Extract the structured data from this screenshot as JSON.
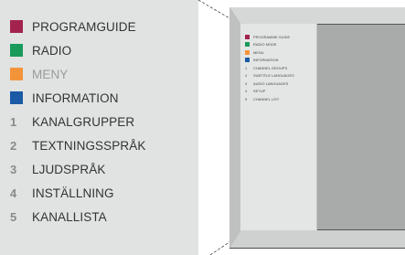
{
  "menu": {
    "items": [
      {
        "label": "PROGRAMGUIDE",
        "marker": "swatch",
        "color": "#a3234f",
        "muted": false
      },
      {
        "label": "RADIO",
        "marker": "swatch",
        "color": "#1a9a5b",
        "muted": false
      },
      {
        "label": "MENY",
        "marker": "swatch",
        "color": "#f4943a",
        "muted": true
      },
      {
        "label": "INFORMATION",
        "marker": "swatch",
        "color": "#1a5aa6",
        "muted": false
      },
      {
        "label": "KANALGRUPPER",
        "marker": "number",
        "number": "1",
        "muted": false
      },
      {
        "label": "TEXTNINGSSPRÅK",
        "marker": "number",
        "number": "2",
        "muted": false
      },
      {
        "label": "LJUDSPRÅK",
        "marker": "number",
        "number": "3",
        "muted": false
      },
      {
        "label": "INSTÄLLNING",
        "marker": "number",
        "number": "4",
        "muted": false
      },
      {
        "label": "KANALLISTA",
        "marker": "number",
        "number": "5",
        "muted": false
      }
    ]
  },
  "tv_screen_menu": {
    "items": [
      {
        "label": "PROGRAMME GUIDE",
        "marker": "swatch",
        "color": "#a3234f"
      },
      {
        "label": "RADIO MODE",
        "marker": "swatch",
        "color": "#1a9a5b"
      },
      {
        "label": "MENU",
        "marker": "swatch",
        "color": "#f4943a"
      },
      {
        "label": "INFORMATION",
        "marker": "swatch",
        "color": "#1a5aa6"
      },
      {
        "label": "CHANNEL GROUPS",
        "marker": "number",
        "number": "1"
      },
      {
        "label": "SUBTITLE LANGUAGES",
        "marker": "number",
        "number": "2"
      },
      {
        "label": "AUDIO LANGUAGES",
        "marker": "number",
        "number": "3"
      },
      {
        "label": "SETUP",
        "marker": "number",
        "number": "4"
      },
      {
        "label": "CHANNEL LIST",
        "marker": "number",
        "number": "5"
      }
    ]
  }
}
